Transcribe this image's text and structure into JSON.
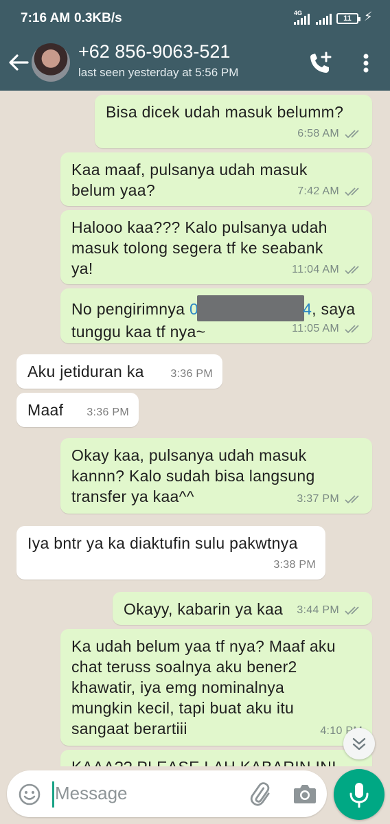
{
  "status": {
    "time": "7:16 AM",
    "speed": "0.3KB/s",
    "network": "4G",
    "battery": "11"
  },
  "header": {
    "contact": "+62 856-9063-521",
    "last_seen": "last seen yesterday at 5:56 PM"
  },
  "messages": [
    {
      "dir": "out",
      "text": "Bisa dicek udah masuk belumm?",
      "time": "6:58 AM"
    },
    {
      "dir": "out",
      "line1": "Kaa maaf, pulsanya udah masuk",
      "line2": "belum yaa?",
      "time": "7:42 AM"
    },
    {
      "dir": "out",
      "line1": "Halooo kaa??? Kalo pulsanya udah",
      "line2": "masuk tolong segera tf ke seabank",
      "line3": "ya!",
      "time": "11:04 AM"
    },
    {
      "dir": "out",
      "pre": "No pengirimnya ",
      "link_start": "0",
      "link_end": "4",
      "post": ", saya",
      "line2": "tunggu kaa tf nya~",
      "time": "11:05 AM"
    },
    {
      "dir": "in",
      "text": "Aku jetiduran ka",
      "time": "3:36 PM"
    },
    {
      "dir": "in",
      "text": "Maaf",
      "time": "3:36 PM"
    },
    {
      "dir": "out",
      "line1": "Okay kaa, pulsanya udah masuk",
      "line2": "kannn? Kalo sudah bisa langsung",
      "line3": "transfer ya kaa^^",
      "time": "3:37 PM"
    },
    {
      "dir": "in",
      "text": "Iya bntr ya ka diaktufin sulu pakwtnya",
      "time": "3:38 PM"
    },
    {
      "dir": "out",
      "text": "Okayy, kabarin ya kaa",
      "time": "3:44 PM"
    },
    {
      "dir": "out",
      "line1": "Ka udah belum yaa tf nya? Maaf aku",
      "line2": "chat teruss soalnya aku bener2",
      "line3": "khawatir, iya emg nominalnya",
      "line4": "mungkin kecil, tapi buat aku itu",
      "line5": "sangaat berartiii",
      "time": "4:10 PM"
    },
    {
      "dir": "out",
      "text": "KAAA?? PLEASE LAH KABARIN INI"
    }
  ],
  "input": {
    "placeholder": "Message"
  },
  "colors": {
    "header": "#3e5c66",
    "outgoing_bubble": "#e1f7cc",
    "incoming_bubble": "#ffffff",
    "wallpaper": "#e6ded4",
    "accent": "#00a884"
  },
  "icons": [
    "back-arrow-icon",
    "add-call-icon",
    "more-vert-icon",
    "double-check-icon",
    "chevrons-down-icon",
    "emoji-icon",
    "attach-icon",
    "camera-icon",
    "mic-icon"
  ]
}
